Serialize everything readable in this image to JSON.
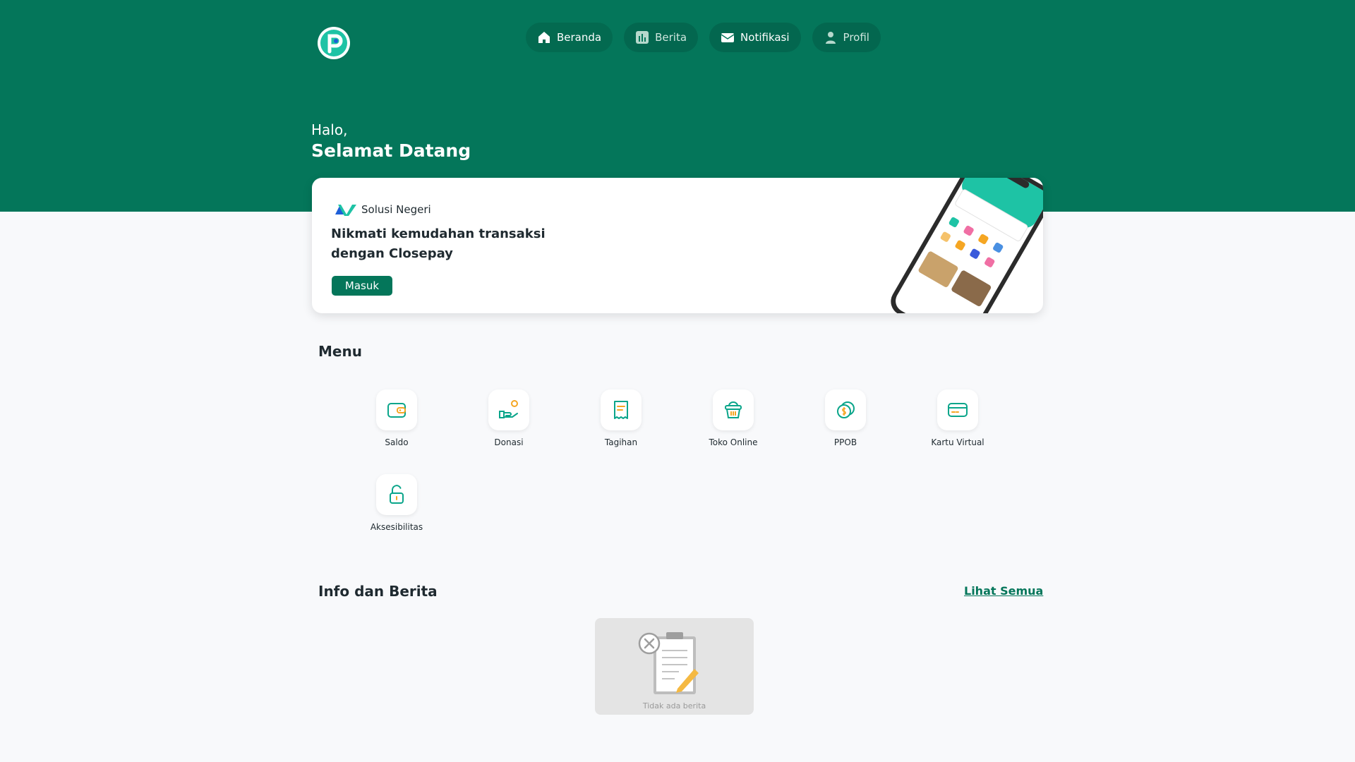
{
  "colors": {
    "primary": "#04765a",
    "accent": "#1ec3a5",
    "background": "#f8f9fb"
  },
  "nav": {
    "items": [
      {
        "label": "Beranda",
        "icon": "home-icon"
      },
      {
        "label": "Berita",
        "icon": "chart-icon"
      },
      {
        "label": "Notifikasi",
        "icon": "mail-icon"
      },
      {
        "label": "Profil",
        "icon": "user-icon"
      }
    ]
  },
  "hero": {
    "greeting": "Halo,",
    "welcome": "Selamat Datang"
  },
  "banner": {
    "brand": "Solusi Negeri",
    "line1": "Nikmati kemudahan transaksi",
    "line2": "dengan Closepay",
    "button": "Masuk"
  },
  "menu": {
    "title": "Menu",
    "items": [
      {
        "label": "Saldo",
        "icon": "wallet-icon"
      },
      {
        "label": "Donasi",
        "icon": "donation-icon"
      },
      {
        "label": "Tagihan",
        "icon": "bill-icon"
      },
      {
        "label": "Toko Online",
        "icon": "basket-icon"
      },
      {
        "label": "PPOB",
        "icon": "coin-icon"
      },
      {
        "label": "Kartu Virtual",
        "icon": "card-icon"
      },
      {
        "label": "Aksesibilitas",
        "icon": "unlock-icon"
      }
    ]
  },
  "news": {
    "title": "Info dan Berita",
    "see_all": "Lihat Semua",
    "empty": "Tidak ada berita"
  }
}
